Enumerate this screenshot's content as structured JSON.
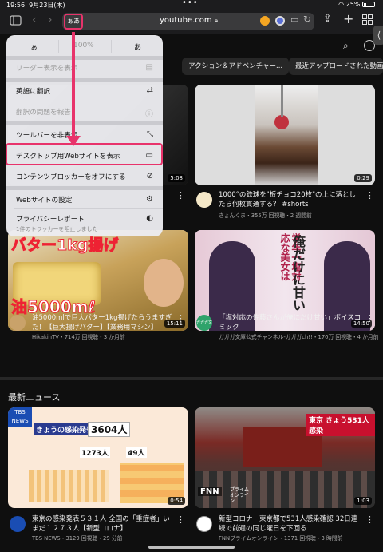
{
  "status_bar": {
    "time": "19:56",
    "date": "9月23日(木)",
    "dots": "•••",
    "battery": "25%"
  },
  "browser": {
    "text_size_button": "ぁあ",
    "url": "youtube.com",
    "icons": [
      "sidebar-icon",
      "back-icon",
      "forward-icon",
      "lock-icon",
      "extension-icon",
      "share-icon",
      "new-tab-icon",
      "tabs-grid-icon"
    ]
  },
  "menu": {
    "font_small": "ぁ",
    "zoom": "100%",
    "font_large": "あ",
    "items": [
      {
        "label": "リーダー表示を表示",
        "disabled": true,
        "icon": "reader-icon"
      },
      {
        "label": "英語に翻訳",
        "disabled": false,
        "icon": "translate-icon"
      },
      {
        "label": "翻訳の問題を報告",
        "disabled": true,
        "icon": "report-icon"
      },
      {
        "label": "ツールバーを非表示",
        "disabled": false,
        "icon": "expand-icon"
      },
      {
        "label": "デスクトップ用Webサイトを表示",
        "disabled": false,
        "icon": "desktop-icon"
      },
      {
        "label": "コンテンツブロッカーをオフにする",
        "disabled": false,
        "icon": "blocker-icon"
      },
      {
        "label": "Webサイトの設定",
        "disabled": false,
        "icon": "settings-icon"
      },
      {
        "label": "プライバシーレポート",
        "disabled": false,
        "icon": "shield-icon"
      }
    ],
    "privacy_sub": "1件のトラッカーを阻止しました"
  },
  "chips": [
    "アクション＆アドベンチャー...",
    "最近アップロードされた動画"
  ],
  "videos": [
    {
      "duration": "5:08"
    },
    {
      "duration": "0:29",
      "title": "1000°の鉄球を\"板チョコ20枚\"の上に落としたら何枚貫通する？ #shorts",
      "meta": "きょんくま・355万 回視聴・2 週間前"
    },
    {
      "duration": "15:11",
      "title": "油5000mlで巨大バター1kg揚げたらうますぎた！【巨大揚げバター】【業務用マシン】",
      "meta": "HikakinTV・714万 回視聴・3 か月前",
      "thumb_text_1": "バター1kg揚げ",
      "thumb_text_2": "油5000mℓ"
    },
    {
      "duration": "14:50",
      "title": "「塩対応の佐藤さんが俺にだけ甘い」ボイスコミック",
      "meta": "ガガガ文庫公式チャンネル-ガガガch!!・170万 回視聴・4 か月前",
      "thumb_text_1": "学年一塩対応な美女は",
      "thumb_text_2": "俺だけに甘い",
      "avatar_text": "ガガガ文庫"
    }
  ],
  "news": {
    "section_title": "最新ニュース",
    "items": [
      {
        "duration": "0:54",
        "title": "東京の感染発表５３１人 全国の「重症者」いまだ１２７３人【新型コロナ】",
        "meta": "TBS NEWS・3129 回視聴・29 分前",
        "badge": "TBS NEWS",
        "thumb_head": "きょうの感染発表",
        "thumb_num": "3604人",
        "thumb_sub": "1273人",
        "thumb_sub2": "49人"
      },
      {
        "duration": "1:03",
        "title": "新型コロナ　東京都で531人感染確認 32日連続で前週の同じ曜日を下回る",
        "meta": "FNNプライムオンライン・1371 回視聴・3 時間前",
        "badge": "FNN",
        "badge_sub": "プライム オンライン",
        "thumb_head": "東京 きょう531人感染"
      }
    ]
  },
  "colors": {
    "accent": "#e8336b",
    "bg": "#0f0f0f",
    "menu_bg": "#ececf0"
  }
}
